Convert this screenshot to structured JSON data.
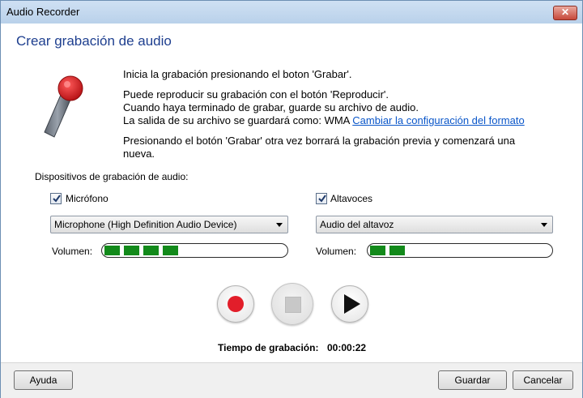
{
  "window": {
    "title": "Audio Recorder",
    "close_glyph": "✕"
  },
  "heading": "Crear grabación de audio",
  "instructions": {
    "line1": "Inicia la grabación presionando el boton 'Grabar'.",
    "line2": "Puede reproducir su grabación con el botón 'Reproducir'.",
    "line3": "Cuando haya terminado de grabar, guarde su archivo de audio.",
    "line4_prefix": "La salida de su archivo se guardará como: WMA",
    "line4_link": "Cambiar la configuración del formato",
    "line5": "Presionando el botón 'Grabar' otra vez borrará la grabación previa y comenzará una",
    "line6": "nueva."
  },
  "devices": {
    "label": "Dispositivos de grabación de audio:",
    "microphone": {
      "checkbox_label": "Micrófono",
      "checked": true,
      "selected": "Microphone (High Definition Audio Device)",
      "volume_label": "Volumen:",
      "volume_segments": 4
    },
    "speakers": {
      "checkbox_label": "Altavoces",
      "checked": true,
      "selected": "Audio del altavoz",
      "volume_label": "Volumen:",
      "volume_segments": 2
    }
  },
  "controls": {
    "record_icon": "record-icon",
    "stop_icon": "stop-icon",
    "play_icon": "play-icon"
  },
  "timer": {
    "label": "Tiempo de grabación:",
    "value": "00:00:22"
  },
  "footer": {
    "help": "Ayuda",
    "save": "Guardar",
    "cancel": "Cancelar"
  },
  "colors": {
    "accent_heading": "#1e3f8f",
    "link": "#0a56c9",
    "meter_fill": "#138a1b",
    "record_red": "#e21e2a"
  }
}
